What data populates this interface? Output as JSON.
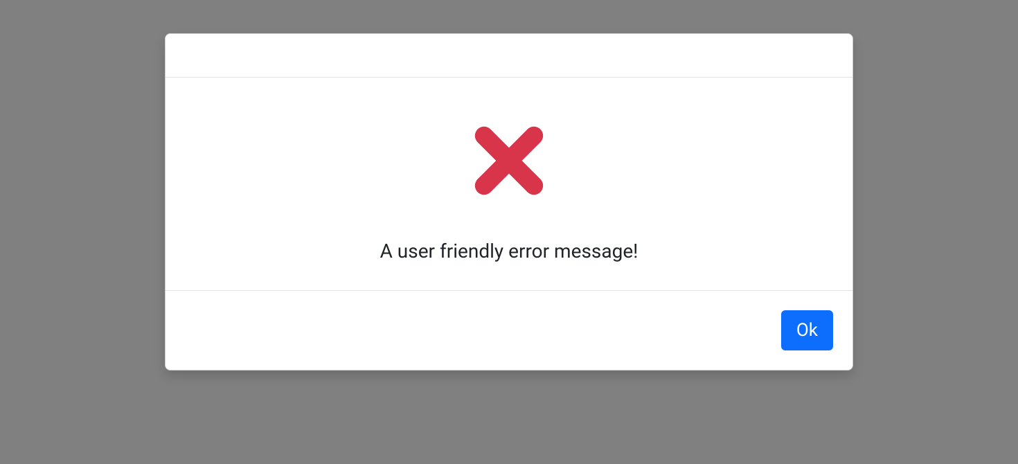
{
  "modal": {
    "message": "A user friendly error message!",
    "ok_label": "Ok",
    "icon_color": "#d8344a"
  }
}
